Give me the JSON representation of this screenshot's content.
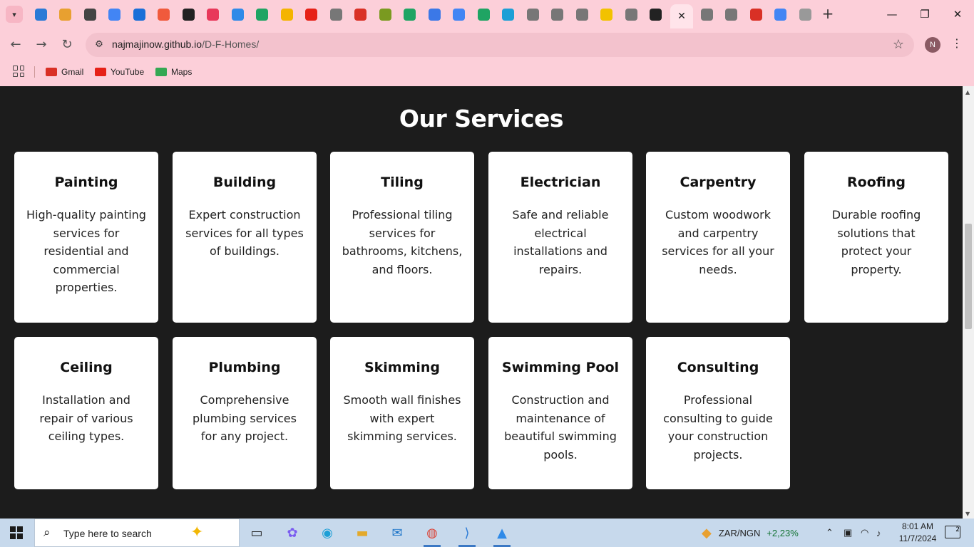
{
  "browser": {
    "tabs": [
      {
        "icon": "vscode-icon",
        "color": "#2a7ad6"
      },
      {
        "icon": "chart-icon",
        "color": "#e8a030"
      },
      {
        "icon": "openai-icon",
        "color": "#444444"
      },
      {
        "icon": "lens-icon",
        "color": "#4285f4"
      },
      {
        "icon": "bitbucket-icon",
        "color": "#1a6fd8"
      },
      {
        "icon": "chat-icon",
        "color": "#f05a3c"
      },
      {
        "icon": "github-icon",
        "color": "#222222"
      },
      {
        "icon": "butterfly-icon",
        "color": "#e8385a"
      },
      {
        "icon": "appstore-icon",
        "color": "#2f8ae8"
      },
      {
        "icon": "play-icon",
        "color": "#1fa463"
      },
      {
        "icon": "pinwheel-icon",
        "color": "#f4b400"
      },
      {
        "icon": "youtube-icon",
        "color": "#e62117"
      },
      {
        "icon": "globe-icon",
        "color": "#777777"
      },
      {
        "icon": "gmail-icon",
        "color": "#d93025"
      },
      {
        "icon": "circle-icon",
        "color": "#7a9a20"
      },
      {
        "icon": "drive-icon",
        "color": "#1fa463"
      },
      {
        "icon": "docs-icon",
        "color": "#3b78e7"
      },
      {
        "icon": "google-icon",
        "color": "#4285f4"
      },
      {
        "icon": "play-icon",
        "color": "#1fa463"
      },
      {
        "icon": "edge-icon",
        "color": "#1c9fd6"
      },
      {
        "icon": "globe-icon",
        "color": "#777777"
      },
      {
        "icon": "globe-icon",
        "color": "#777777"
      },
      {
        "icon": "globe-icon",
        "color": "#777777"
      },
      {
        "icon": "bolt-icon",
        "color": "#f2c200"
      },
      {
        "icon": "globe-icon",
        "color": "#777777"
      },
      {
        "icon": "github-icon",
        "color": "#222222"
      }
    ],
    "tabs_after": [
      {
        "icon": "globe-icon",
        "color": "#777777"
      },
      {
        "icon": "globe-icon",
        "color": "#777777"
      },
      {
        "icon": "gmail-icon",
        "color": "#d93025"
      },
      {
        "icon": "google-icon",
        "color": "#4285f4"
      },
      {
        "icon": "globe-icon",
        "color": "#999999"
      }
    ],
    "active_tab_close": "✕",
    "new_tab": "+",
    "url_host": "najmajinow.github.io",
    "url_path": "/D-F-Homes/",
    "profile_initial": "N",
    "bookmarks": [
      {
        "label": "Gmail",
        "icon": "gmail-icon",
        "color": "#d93025"
      },
      {
        "label": "YouTube",
        "icon": "youtube-icon",
        "color": "#e62117"
      },
      {
        "label": "Maps",
        "icon": "maps-icon",
        "color": "#34a853"
      }
    ]
  },
  "page": {
    "title": "Our Services",
    "services": [
      {
        "name": "Painting",
        "desc": "High-quality painting services for residential and commercial properties."
      },
      {
        "name": "Building",
        "desc": "Expert construction services for all types of buildings."
      },
      {
        "name": "Tiling",
        "desc": "Professional tiling services for bathrooms, kitchens, and floors."
      },
      {
        "name": "Electrician",
        "desc": "Safe and reliable electrical installations and repairs."
      },
      {
        "name": "Carpentry",
        "desc": "Custom woodwork and carpentry services for all your needs."
      },
      {
        "name": "Roofing",
        "desc": "Durable roofing solutions that protect your property."
      },
      {
        "name": "Ceiling",
        "desc": "Installation and repair of various ceiling types."
      },
      {
        "name": "Plumbing",
        "desc": "Comprehensive plumbing services for any project."
      },
      {
        "name": "Skimming",
        "desc": "Smooth wall finishes with expert skimming services."
      },
      {
        "name": "Swimming Pool",
        "desc": "Construction and maintenance of beautiful swimming pools."
      },
      {
        "name": "Consulting",
        "desc": "Professional consulting to guide your construction projects."
      }
    ]
  },
  "taskbar": {
    "search_placeholder": "Type here to search",
    "ticker_label": "ZAR/NGN",
    "ticker_value": "+2,23%",
    "time": "8:01 AM",
    "date": "11/7/2024",
    "notifications": "2",
    "accent": "#3b78c4"
  }
}
